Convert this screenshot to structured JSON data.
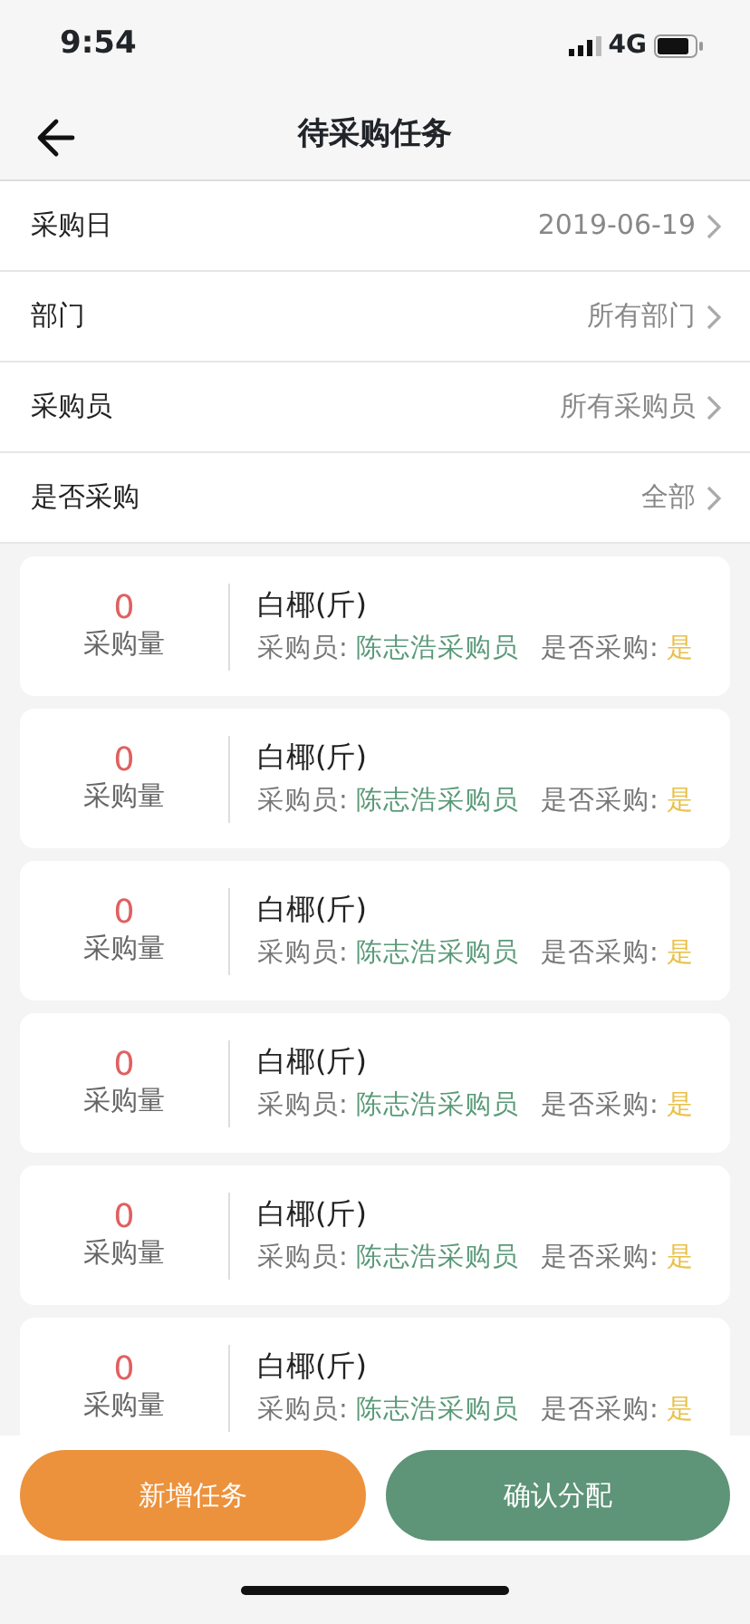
{
  "status_bar": {
    "time": "9:54",
    "network": "4G"
  },
  "nav": {
    "title": "待采购任务"
  },
  "filters": [
    {
      "label": "采购日",
      "value": "2019-06-19"
    },
    {
      "label": "部门",
      "value": "所有部门"
    },
    {
      "label": "采购员",
      "value": "所有采购员"
    },
    {
      "label": "是否采购",
      "value": "全部"
    }
  ],
  "tasks": [
    {
      "quantity": "0",
      "quantity_label": "采购量",
      "name": "白椰(斤)",
      "buyer_label": "采购员:",
      "buyer": "陈志浩采购员",
      "purchased_label": "是否采购:",
      "purchased": "是"
    },
    {
      "quantity": "0",
      "quantity_label": "采购量",
      "name": "白椰(斤)",
      "buyer_label": "采购员:",
      "buyer": "陈志浩采购员",
      "purchased_label": "是否采购:",
      "purchased": "是"
    },
    {
      "quantity": "0",
      "quantity_label": "采购量",
      "name": "白椰(斤)",
      "buyer_label": "采购员:",
      "buyer": "陈志浩采购员",
      "purchased_label": "是否采购:",
      "purchased": "是"
    },
    {
      "quantity": "0",
      "quantity_label": "采购量",
      "name": "白椰(斤)",
      "buyer_label": "采购员:",
      "buyer": "陈志浩采购员",
      "purchased_label": "是否采购:",
      "purchased": "是"
    },
    {
      "quantity": "0",
      "quantity_label": "采购量",
      "name": "白椰(斤)",
      "buyer_label": "采购员:",
      "buyer": "陈志浩采购员",
      "purchased_label": "是否采购:",
      "purchased": "是"
    },
    {
      "quantity": "0",
      "quantity_label": "采购量",
      "name": "白椰(斤)",
      "buyer_label": "采购员:",
      "buyer": "陈志浩采购员",
      "purchased_label": "是否采购:",
      "purchased": "是"
    }
  ],
  "buttons": [
    {
      "label": "新增任务",
      "kind": "secondary"
    },
    {
      "label": "确认分配",
      "kind": "primary"
    }
  ]
}
